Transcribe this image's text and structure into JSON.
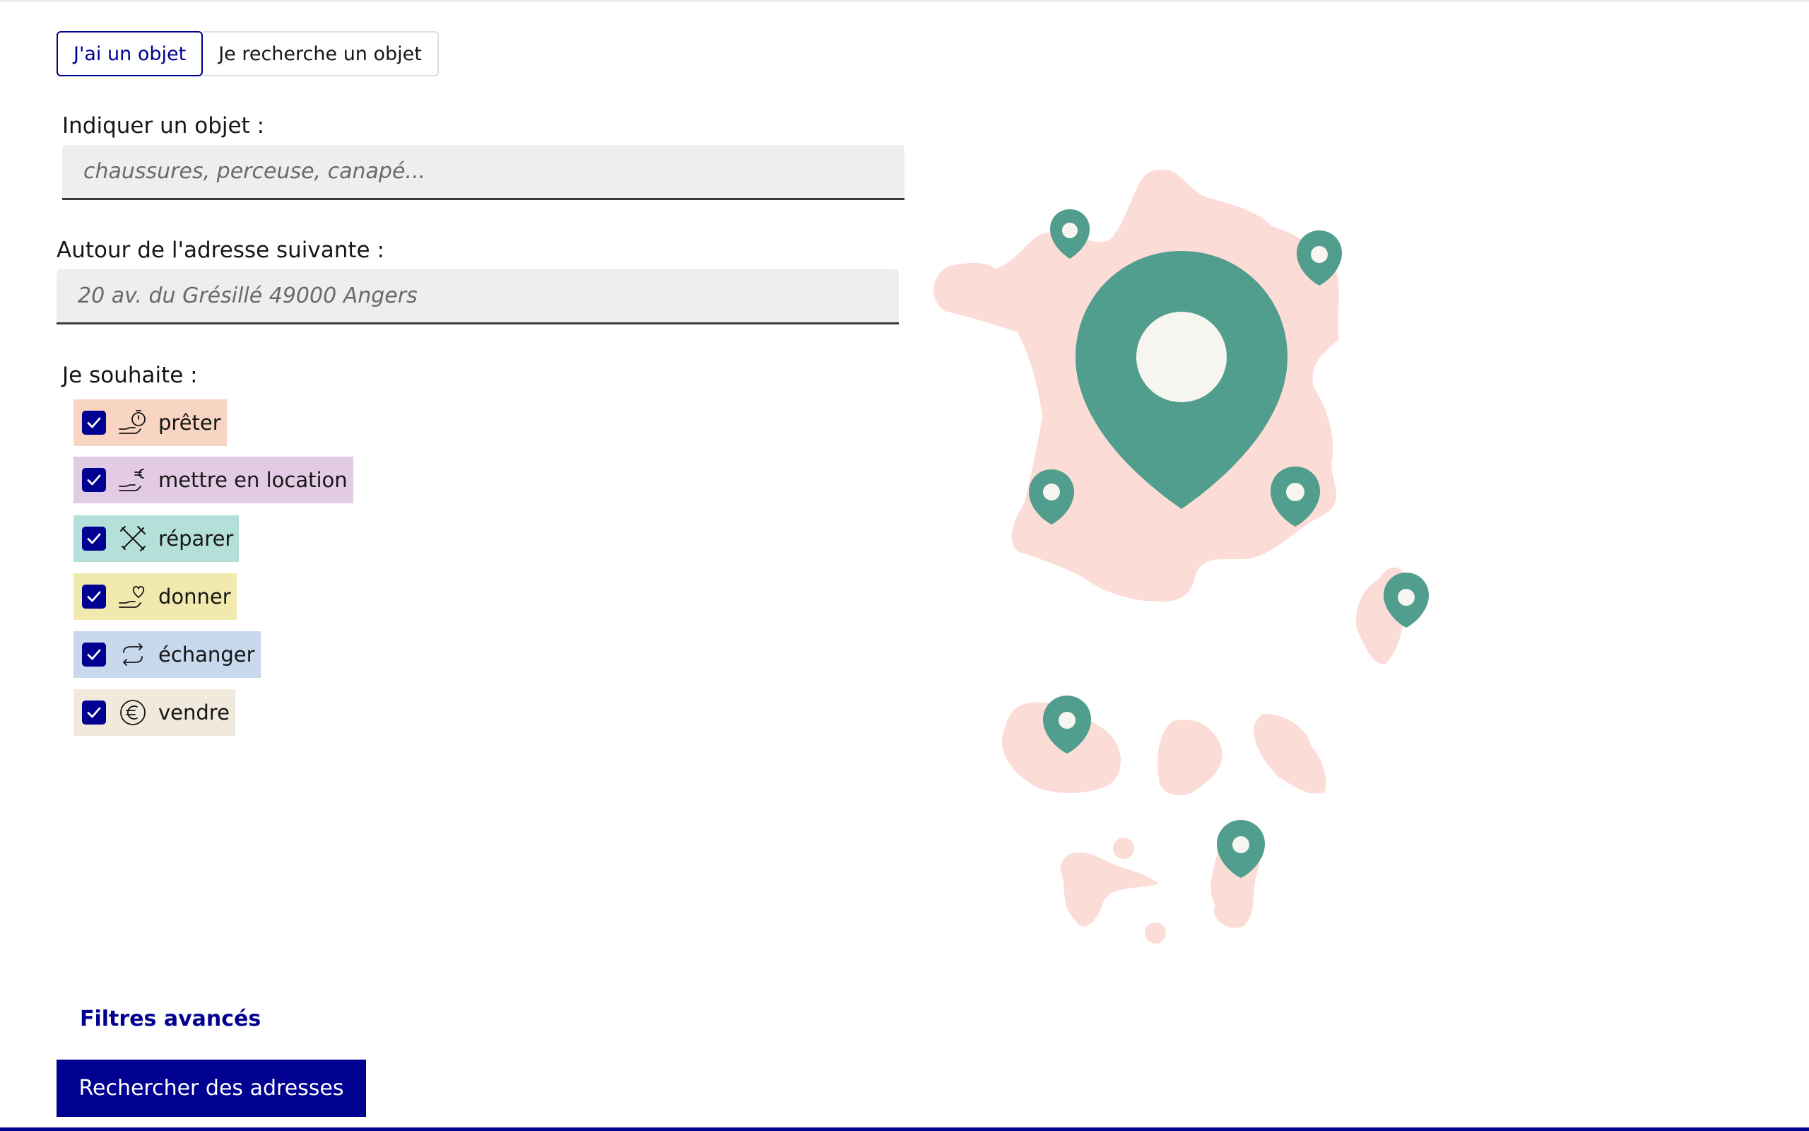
{
  "tabs": {
    "have_object": "J'ai un objet",
    "search_object": "Je recherche un objet"
  },
  "object_field": {
    "label": "Indiquer un objet :",
    "placeholder": "chaussures, perceuse, canapé..."
  },
  "address_field": {
    "label": "Autour de l'adresse suivante :",
    "placeholder": "20 av. du Grésillé 49000 Angers"
  },
  "wish": {
    "label": "Je souhaite :",
    "options": [
      {
        "label": "prêter",
        "icon": "hand-timer-icon",
        "color": "#f8d4c2",
        "checked": true
      },
      {
        "label": "mettre en location",
        "icon": "hand-euro-icon",
        "color": "#e3cbe5",
        "checked": true
      },
      {
        "label": "réparer",
        "icon": "tools-icon",
        "color": "#b4e0da",
        "checked": true
      },
      {
        "label": "donner",
        "icon": "hand-heart-icon",
        "color": "#f2e9ae",
        "checked": true
      },
      {
        "label": "échanger",
        "icon": "exchange-icon",
        "color": "#c8d9ee",
        "checked": true
      },
      {
        "label": "vendre",
        "icon": "euro-circle-icon",
        "color": "#f1e9dc",
        "checked": true
      }
    ]
  },
  "advanced_filters": "Filtres avancés",
  "search_button": "Rechercher des adresses",
  "colors": {
    "primary": "#000091",
    "map_land": "#fcdcd6",
    "map_pin": "#519d8e"
  }
}
